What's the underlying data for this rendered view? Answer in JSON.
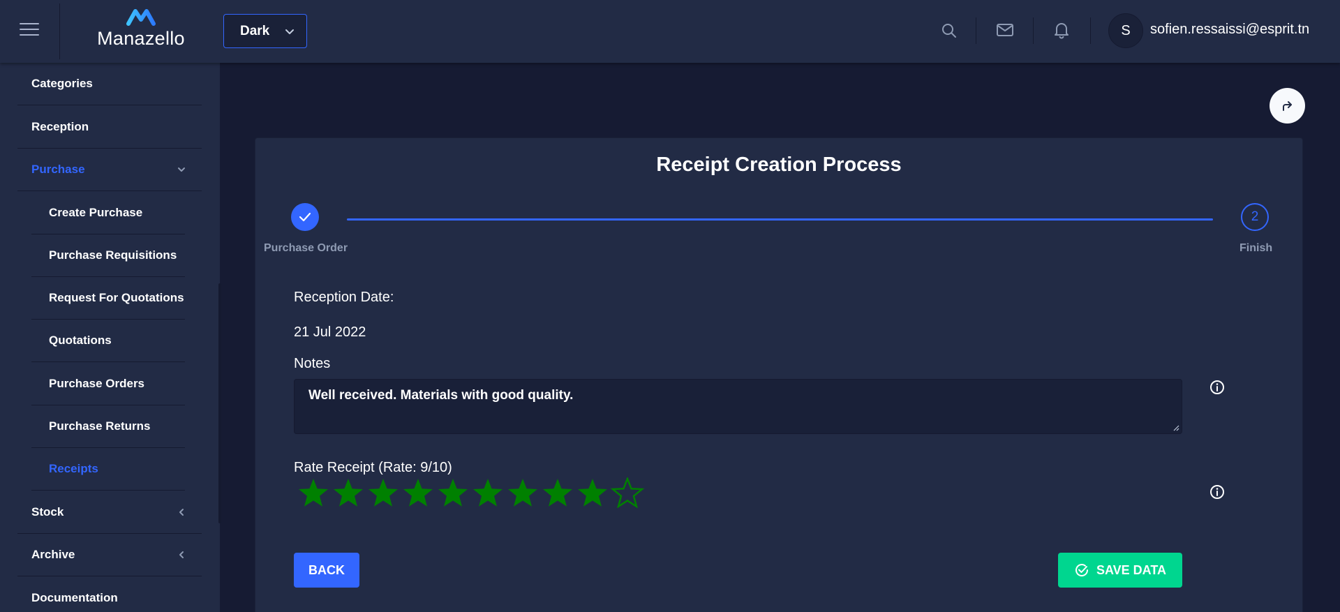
{
  "header": {
    "logo_text": "Manazello",
    "theme_selected": "Dark",
    "user_initial": "S",
    "user_email": "sofien.ressaissi@esprit.tn",
    "icons": [
      "menu-icon",
      "search-icon",
      "mail-icon",
      "bell-icon",
      "chevron-down-icon"
    ]
  },
  "sidebar": {
    "items": [
      {
        "label": "Categories",
        "level": "top"
      },
      {
        "label": "Reception",
        "level": "top"
      },
      {
        "label": "Purchase",
        "level": "top",
        "active": true,
        "expanded": true
      },
      {
        "label": "Create Purchase",
        "level": "sub"
      },
      {
        "label": "Purchase Requisitions",
        "level": "sub"
      },
      {
        "label": "Request For Quotations",
        "level": "sub"
      },
      {
        "label": "Quotations",
        "level": "sub"
      },
      {
        "label": "Purchase Orders",
        "level": "sub"
      },
      {
        "label": "Purchase Returns",
        "level": "sub"
      },
      {
        "label": "Receipts",
        "level": "sub",
        "active": true
      },
      {
        "label": "Stock",
        "level": "top",
        "collapsed": true
      },
      {
        "label": "Archive",
        "level": "top",
        "collapsed": true
      },
      {
        "label": "Documentation",
        "level": "top"
      }
    ]
  },
  "main": {
    "title": "Receipt Creation Process",
    "stepper": {
      "steps": [
        {
          "label": "Purchase Order",
          "state": "completed",
          "icon": "check-icon"
        },
        {
          "label": "Finish",
          "state": "current",
          "number": "2"
        }
      ]
    },
    "reception_date_label": "Reception Date:",
    "reception_date_value": "21 Jul 2022",
    "notes_label": "Notes",
    "notes_value": "Well received. Materials with good quality.",
    "rate_label": "Rate Receipt (Rate: 9/10)",
    "rating": {
      "value": 9,
      "max": 10
    },
    "back_label": "BACK",
    "save_label": "SAVE DATA"
  },
  "colors": {
    "primary": "#3366ff",
    "success": "#00d68f",
    "star": "#008000",
    "background": "#161b33",
    "panel": "#222b45"
  }
}
